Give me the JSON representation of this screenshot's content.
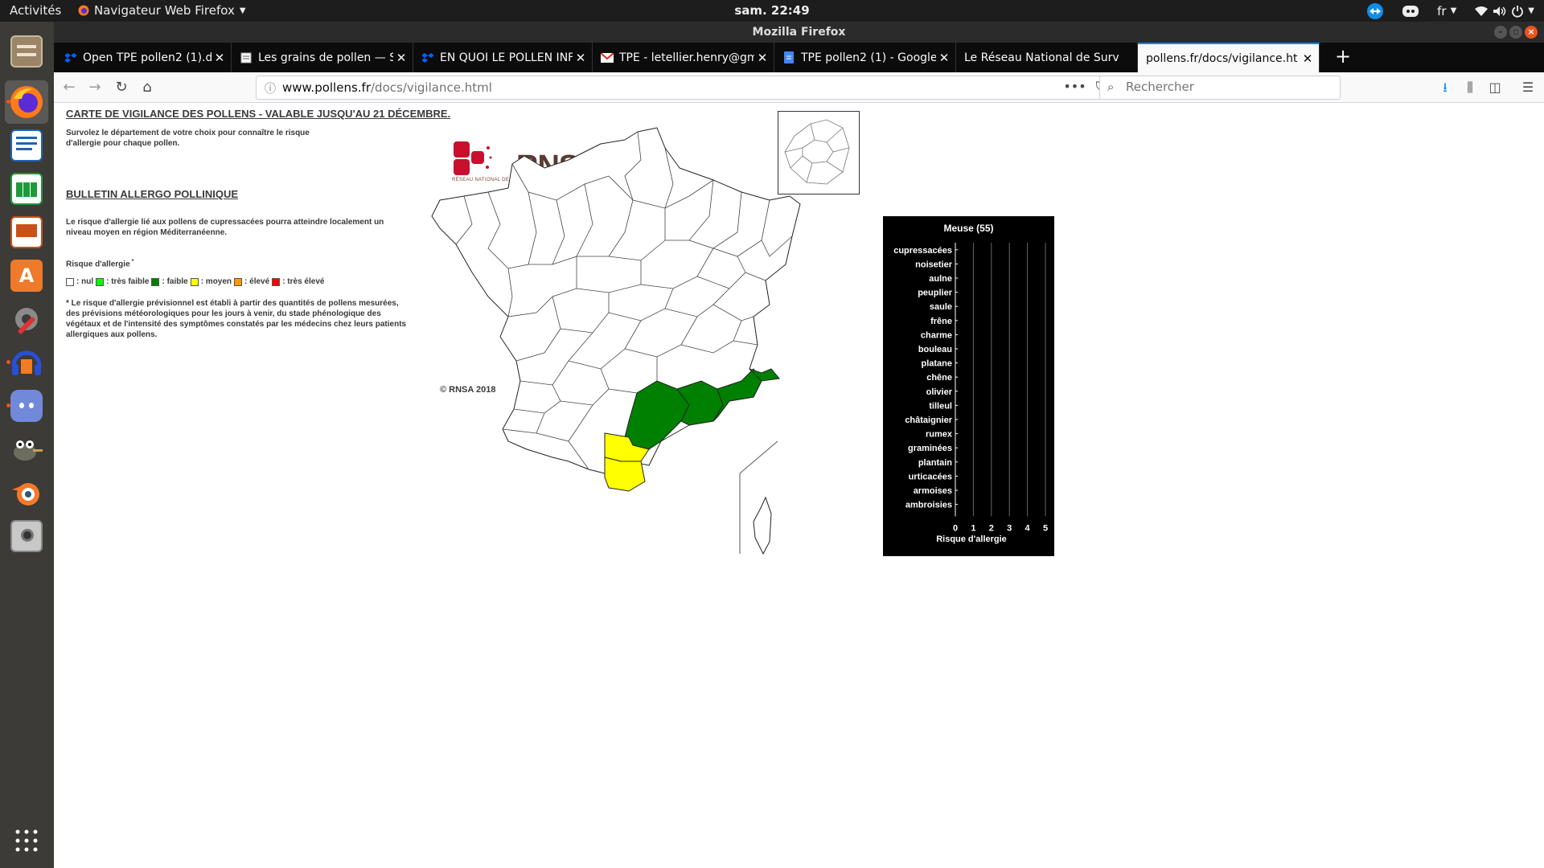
{
  "topbar": {
    "activities": "Activités",
    "app_name": "Navigateur Web Firefox",
    "clock": "sam. 22:49",
    "lang": "fr"
  },
  "dock": {
    "items": [
      {
        "name": "files-icon",
        "color": "#8a6d4f"
      },
      {
        "name": "firefox-icon",
        "color": "#ff7a1a"
      },
      {
        "name": "writer-icon",
        "color": "#1e64b4"
      },
      {
        "name": "calc-icon",
        "color": "#1d9b3b"
      },
      {
        "name": "impress-icon",
        "color": "#c9501a"
      },
      {
        "name": "software-center-icon",
        "color": "#ee7a2a"
      },
      {
        "name": "settings-icon",
        "color": "#7a7a7a"
      },
      {
        "name": "audacity-icon",
        "color": "#2a4fd6"
      },
      {
        "name": "discord-icon",
        "color": "#7289da"
      },
      {
        "name": "gimp-icon",
        "color": "#6d6d5f"
      },
      {
        "name": "blender-icon",
        "color": "#f5792a"
      },
      {
        "name": "screenshot-icon",
        "color": "#9a9a9a"
      },
      {
        "name": "show-apps-icon",
        "color": "#ffffff"
      }
    ]
  },
  "window": {
    "title": "Mozilla Firefox"
  },
  "tabs": [
    {
      "title": "Open TPE pollen2 (1).do",
      "favicon": "dropbox-icon"
    },
    {
      "title": "Les grains de pollen — S",
      "favicon": "page-icon"
    },
    {
      "title": "EN QUOI LE POLLEN INF",
      "favicon": "dropbox-icon"
    },
    {
      "title": "TPE - letellier.henry@gm",
      "favicon": "gmail-icon"
    },
    {
      "title": "TPE pollen2 (1) - Google",
      "favicon": "docs-icon"
    },
    {
      "title": "Le Réseau National de Surv",
      "favicon": "none"
    },
    {
      "title": "pollens.fr/docs/vigilance.ht",
      "favicon": "none"
    }
  ],
  "navbar": {
    "url_domain": "www.pollens.fr",
    "url_path": "/docs/vigilance.html",
    "search_placeholder": "Rechercher"
  },
  "page": {
    "title": "CARTE DE VIGILANCE DES POLLENS - VALABLE JUSQU'AU 21 DÉCEMBRE.",
    "intro": "Survolez le département de votre choix pour connaître le risque d'allergie pour chaque pollen.",
    "bulletin_heading": "BULLETIN ALLERGO POLLINIQUE",
    "bulletin_text": "Le risque d'allergie lié aux pollens de cupressacées pourra atteindre localement un niveau moyen en région Méditerranéenne.",
    "risk_heading": "Risque d'allergie",
    "legend": [
      {
        "label": ": nul",
        "color": "#ffffff"
      },
      {
        "label": ": très faible",
        "color": "#00ff00"
      },
      {
        "label": ": faible",
        "color": "#008000"
      },
      {
        "label": ": moyen",
        "color": "#ffff00"
      },
      {
        "label": ": élevé",
        "color": "#ff9900"
      },
      {
        "label": ": très élevé",
        "color": "#ff0000"
      }
    ],
    "footnote": "* Le risque d'allergie prévisionnel est établi à partir des quantités de pollens mesurées, des prévisions météorologiques pour les jours à venir, du stade phénologique des végétaux et de l'intensité des symptômes constatés par les médecins chez leurs patients allergiques aux pollens.",
    "copyright": "© RNSA 2018",
    "logo_word": "RNSA",
    "logo_tagline": "RÉSEAU NATIONAL DE SURVEILLANCE AÉROBIOLOGIQUE"
  },
  "chart_data": {
    "type": "bar",
    "orientation": "horizontal",
    "title": "Meuse (55)",
    "xlabel": "Risque d'allergie",
    "categories": [
      "cupressacées",
      "noisetier",
      "aulne",
      "peuplier",
      "saule",
      "frêne",
      "charme",
      "bouleau",
      "platane",
      "chêne",
      "olivier",
      "tilleul",
      "châtaignier",
      "rumex",
      "graminées",
      "plantain",
      "urticacées",
      "armoises",
      "ambroisies"
    ],
    "values": [
      0,
      0,
      0,
      0,
      0,
      0,
      0,
      0,
      0,
      0,
      0,
      0,
      0,
      0,
      0,
      0,
      0,
      0,
      0
    ],
    "xlim": [
      0,
      5
    ],
    "xticks": [
      "0",
      "1",
      "2",
      "3",
      "4",
      "5"
    ],
    "grid": true,
    "background": "#000000"
  }
}
